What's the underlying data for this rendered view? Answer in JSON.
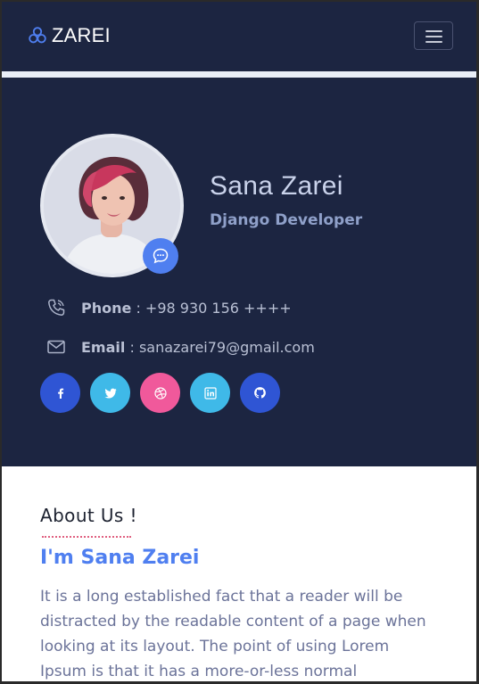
{
  "navbar": {
    "brand_text": "ZAREI",
    "brand_icon": "hexagon-cluster-logo-icon",
    "toggler_icon": "hamburger-menu-icon"
  },
  "hero": {
    "name": "Sana Zarei",
    "role": "Django Developer",
    "avatar_alt": "profile photo",
    "badge_icon": "chat-bubble-icon",
    "phone": {
      "label": "Phone",
      "separator": " : ",
      "value": "+98 930 156 ++++",
      "icon": "phone-icon"
    },
    "email": {
      "label": "Email",
      "separator": " : ",
      "value": "sanazarei79@gmail.com",
      "icon": "envelope-icon"
    },
    "socials": [
      {
        "name": "facebook",
        "icon": "facebook-icon",
        "color": "#2f55d4"
      },
      {
        "name": "twitter",
        "icon": "twitter-icon",
        "color": "#3fb9e8"
      },
      {
        "name": "dribbble",
        "icon": "dribbble-icon",
        "color": "#f0599b"
      },
      {
        "name": "linkedin",
        "icon": "linkedin-icon",
        "color": "#3fb9e8"
      },
      {
        "name": "github",
        "icon": "github-icon",
        "color": "#2f55d4"
      }
    ]
  },
  "about": {
    "title": "About Us !",
    "subtitle": "I'm Sana Zarei",
    "text": "It is a long established fact that a reader will be distracted by the readable content of a page when looking at its layout. The point of using Lorem Ipsum is that it has a more-or-less normal distribution of"
  },
  "colors": {
    "navy": "#1c2541",
    "accent_blue": "#4f7ff0",
    "facebook": "#2f55d4",
    "twitter": "#3fb9e8",
    "dribbble": "#f0599b"
  }
}
